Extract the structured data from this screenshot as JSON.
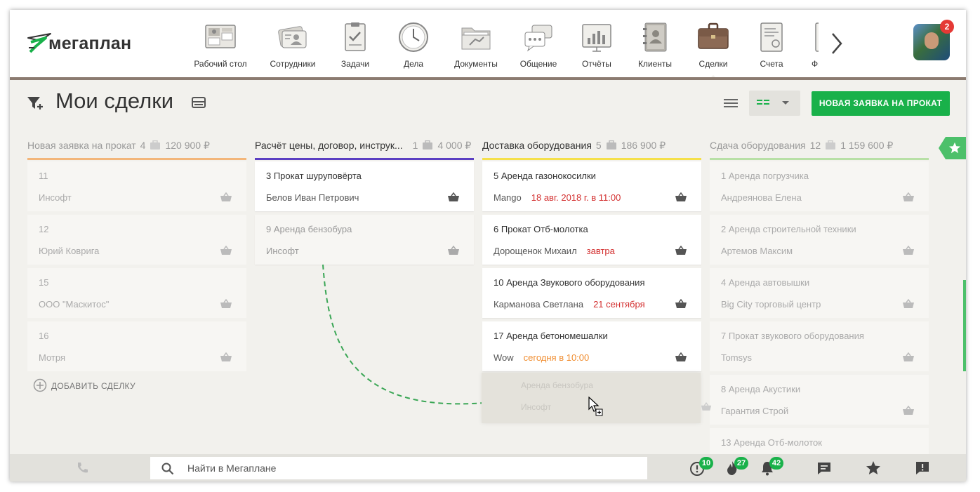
{
  "app": {
    "logo_text": "мегаплан"
  },
  "nav": {
    "items": [
      {
        "label": "Рабочий стол",
        "icon": "desktop-icon"
      },
      {
        "label": "Сотрудники",
        "icon": "employees-icon"
      },
      {
        "label": "Задачи",
        "icon": "tasks-icon"
      },
      {
        "label": "Дела",
        "icon": "clock-icon"
      },
      {
        "label": "Документы",
        "icon": "folder-icon"
      },
      {
        "label": "Общение",
        "icon": "chat-icon"
      },
      {
        "label": "Отчёты",
        "icon": "reports-icon"
      },
      {
        "label": "Клиенты",
        "icon": "clients-icon"
      },
      {
        "label": "Сделки",
        "icon": "briefcase-icon",
        "active": true
      },
      {
        "label": "Счета",
        "icon": "invoice-icon"
      },
      {
        "label": "Фина",
        "icon": "finance-icon"
      }
    ],
    "avatar_badge": "2"
  },
  "header": {
    "title": "Мои сделки",
    "new_button": "НОВАЯ ЗАЯВКА НА ПРОКАТ"
  },
  "columns": [
    {
      "title": "Новая заявка на прокат",
      "count": "4",
      "sum": "120 900 ₽",
      "color": "#f3b67a",
      "dim": true,
      "cards": [
        {
          "title": "11",
          "client": "Инсофт"
        },
        {
          "title": "12",
          "client": "Юрий Коврига"
        },
        {
          "title": "15",
          "client": "ООО \"Маскитос\""
        },
        {
          "title": "16",
          "client": "Мотря"
        }
      ],
      "add_label": "ДОБАВИТЬ СДЕЛКУ"
    },
    {
      "title": "Расчёт цены, договор, инструк...",
      "count": "1",
      "sum": "4 000 ₽",
      "color": "#5b3fc2",
      "dim": false,
      "cards": [
        {
          "title": "3 Прокат шуруповёрта",
          "client": "Белов Иван Петрович"
        },
        {
          "title": "9 Аренда бензобура",
          "client": "Инсофт",
          "dim": true
        }
      ]
    },
    {
      "title": "Доставка оборудования",
      "count": "5",
      "sum": "186 900 ₽",
      "color": "#f5e04a",
      "dim": false,
      "cards": [
        {
          "title": "5 Аренда газонокосилки",
          "client": "Mango",
          "date": "18 авг. 2018 г. в 11:00",
          "date_color": "red"
        },
        {
          "title": "6 Прокат Отб-молотка",
          "client": "Дорощенок Михаил",
          "date": "завтра",
          "date_color": "red"
        },
        {
          "title": "10 Аренда Звукового оборудования",
          "client": "Карманова Светлана",
          "date": "21 сентября",
          "date_color": "red"
        },
        {
          "title": "17 Аренда бетономешалки",
          "client": "Wow",
          "date": "сегодня в 10:00",
          "date_color": "orange"
        }
      ],
      "ghost": {
        "title": "Аренда бензобура",
        "client": "Инсофт"
      }
    },
    {
      "title": "Сдача оборудования",
      "count": "12",
      "sum": "1 159 600 ₽",
      "color": "#b8e0a6",
      "dim": true,
      "cards": [
        {
          "title": "1 Аренда погрузчика",
          "client": "Андреянова Елена"
        },
        {
          "title": "2 Аренда строительной техники",
          "client": "Артемов Максим"
        },
        {
          "title": "4 Аренда автовышки",
          "client": "Big City торговый центр"
        },
        {
          "title": "7 Прокат звукового оборудования",
          "client": "Tomsys"
        },
        {
          "title": "8 Аренда Акустики",
          "client": "Гарантия Строй"
        },
        {
          "title": "13 Аренда Отб-молоток",
          "client": ""
        }
      ]
    }
  ],
  "footer": {
    "search_placeholder": "Найти в Мегаплане",
    "badges": {
      "alerts": "10",
      "hot": "27",
      "notifications": "42"
    }
  },
  "colors": {
    "accent_green": "#19b14a",
    "nav_border": "#8b7b70"
  }
}
